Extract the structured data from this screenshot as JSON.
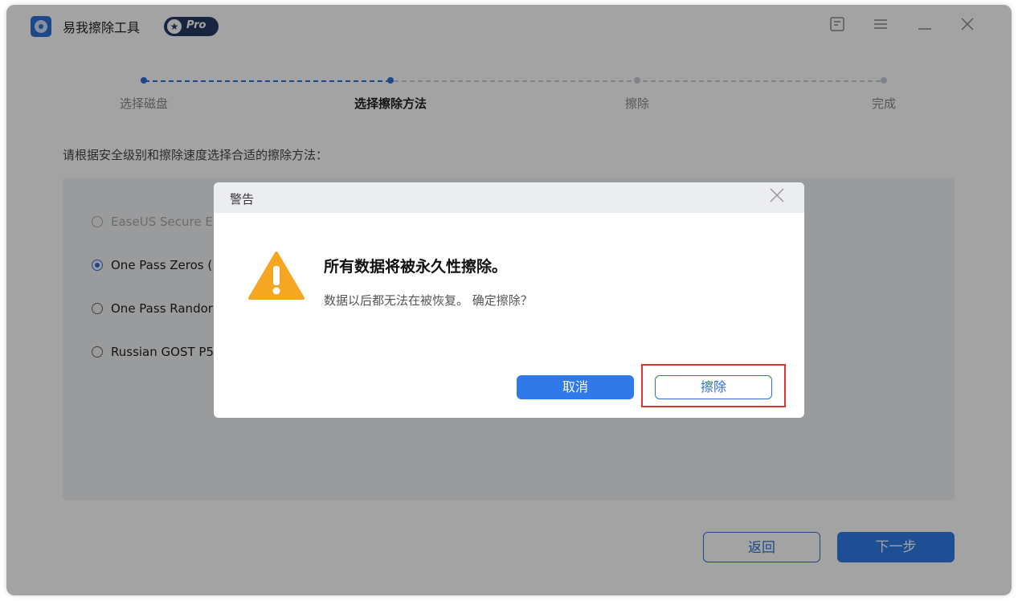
{
  "app": {
    "title": "易我擦除工具",
    "pro_label": "Pro"
  },
  "window_controls": {
    "feedback_icon": "feedback-icon",
    "menu_icon": "menu-icon",
    "minimize_icon": "minimize-icon",
    "close_icon": "close-icon"
  },
  "steps": [
    {
      "label": "选择磁盘",
      "state": "done"
    },
    {
      "label": "选择擦除方法",
      "state": "active"
    },
    {
      "label": "擦除",
      "state": "pending"
    },
    {
      "label": "完成",
      "state": "pending"
    }
  ],
  "instruction": "请根据安全级别和擦除速度选择合适的擦除方法：",
  "methods": [
    {
      "label": "EaseUS Secure Er",
      "selected": false,
      "disabled": true
    },
    {
      "label": "One Pass Zeros (",
      "selected": true,
      "disabled": false
    },
    {
      "label": "One Pass Randor",
      "selected": false,
      "disabled": false
    },
    {
      "label": "Russian GOST P5",
      "selected": false,
      "disabled": false
    }
  ],
  "footer": {
    "back_label": "返回",
    "next_label": "下一步"
  },
  "dialog": {
    "title": "警告",
    "message": "所有数据将被永久性擦除。",
    "sub_message": "数据以后都无法在被恢复。 确定擦除？",
    "cancel_label": "取消",
    "erase_label": "擦除"
  },
  "colors": {
    "accent": "#2f7ae8",
    "warning": "#f5a623",
    "highlight": "#e03232"
  }
}
